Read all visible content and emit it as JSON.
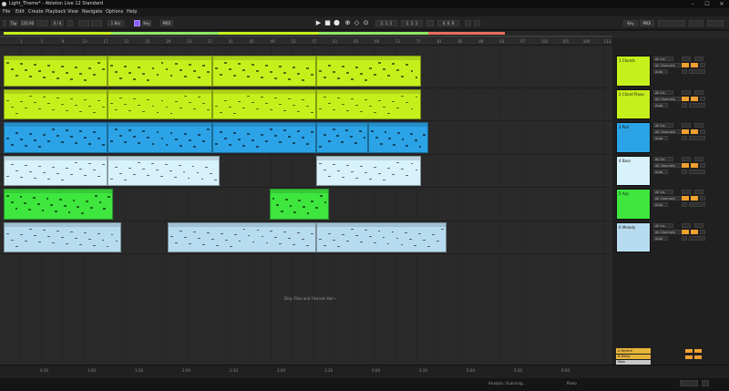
{
  "window": {
    "title": "Light_Theme* - Ableton Live 12 Standard"
  },
  "menu": [
    "File",
    "Edit",
    "Create",
    "Playback",
    "View",
    "Navigate",
    "Options",
    "Help"
  ],
  "control": {
    "tap": "Tap",
    "tempo": "120.00",
    "signature": "4 / 4",
    "metronome": "1 Bar",
    "position": "1. 1. 1",
    "loop_start": "1. 1. 1",
    "loop_length": "4. 0. 0",
    "key": "Key",
    "midi": "MIDI"
  },
  "ruler": {
    "bars": [
      "1",
      "5",
      "9",
      "13",
      "17",
      "21",
      "25",
      "29",
      "33",
      "37",
      "41",
      "45",
      "49",
      "53",
      "57",
      "61",
      "65",
      "69",
      "73",
      "77",
      "81",
      "85",
      "89",
      "93",
      "97",
      "101",
      "105",
      "109",
      "113"
    ]
  },
  "timeline": {
    "labels": [
      "0:30",
      "1:00",
      "1:30",
      "2:00",
      "2:30",
      "3:00",
      "3:30",
      "4:00",
      "4:30",
      "5:00",
      "5:30",
      "6:00"
    ]
  },
  "arrangement": {
    "drop_hint": "Drop Files and Devices Here"
  },
  "tracks": [
    {
      "name": "1 Chords",
      "color": "#c6f01c",
      "input": "All Ins",
      "channel": "All Channels",
      "monitor": "Auto",
      "clips": [
        {
          "start": 0,
          "end": 4
        },
        {
          "start": 4,
          "end": 8
        },
        {
          "start": 8,
          "end": 12
        },
        {
          "start": 12,
          "end": 16
        }
      ]
    },
    {
      "name": "2 Chord Piano",
      "color": "#c6f01c",
      "input": "All Ins",
      "channel": "All Channels",
      "monitor": "Auto",
      "clips": [
        {
          "start": 0,
          "end": 4
        },
        {
          "start": 4,
          "end": 8
        },
        {
          "start": 8,
          "end": 12
        },
        {
          "start": 12,
          "end": 16
        }
      ]
    },
    {
      "name": "3 Pad",
      "color": "#2ba3e6",
      "input": "All Ins",
      "channel": "All Channels",
      "monitor": "Auto",
      "clips": [
        {
          "start": 0,
          "end": 4
        },
        {
          "start": 4,
          "end": 8
        },
        {
          "start": 8,
          "end": 12
        },
        {
          "start": 12,
          "end": 14
        },
        {
          "start": 14,
          "end": 16.3
        }
      ]
    },
    {
      "name": "4 Bass",
      "color": "#d7f2fa",
      "input": "All Ins",
      "channel": "All Channels",
      "monitor": "Auto",
      "clips": [
        {
          "start": 0,
          "end": 4
        },
        {
          "start": 4,
          "end": 8.3
        },
        {
          "start": 12,
          "end": 16
        }
      ]
    },
    {
      "name": "5 Arp",
      "color": "#3ee63e",
      "input": "All Ins",
      "channel": "All Channels",
      "monitor": "Auto",
      "clips": [
        {
          "start": 0,
          "end": 4.2
        },
        {
          "start": 10.2,
          "end": 12.5
        }
      ]
    },
    {
      "name": "6 Melody",
      "color": "#b8dcef",
      "input": "All Ins",
      "channel": "All Channels",
      "monitor": "Auto",
      "clips": [
        {
          "start": 0,
          "end": 4.5
        },
        {
          "start": 6.3,
          "end": 12
        },
        {
          "start": 12,
          "end": 17
        }
      ]
    }
  ],
  "returns": [
    {
      "name": "A Reverb"
    },
    {
      "name": "B Delay"
    }
  ],
  "master": {
    "name": "Main"
  },
  "status": {
    "left": "Analysis: Scanning...",
    "right": "Piano"
  }
}
